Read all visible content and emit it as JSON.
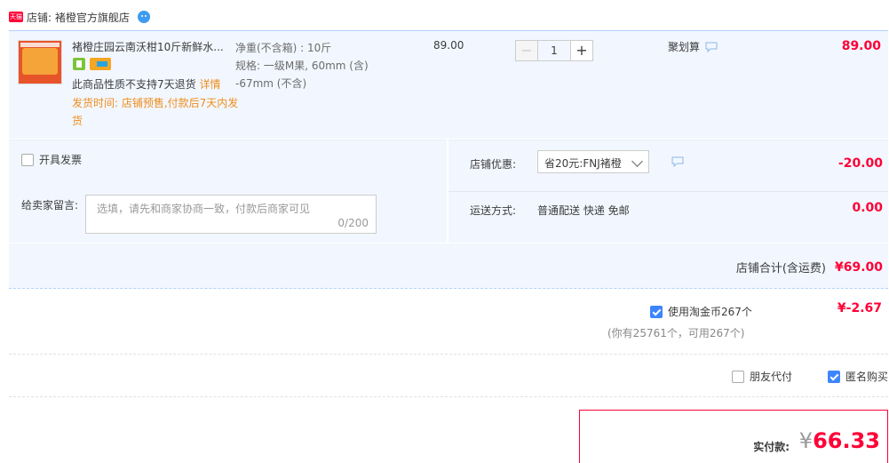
{
  "shop": {
    "badge": "天猫",
    "label": "店铺: 褚橙官方旗舰店"
  },
  "item": {
    "title": "褚橙庄园云南沃柑10斤新鲜水...",
    "service_note": "此商品性质不支持7天退货",
    "detail_link": "详情",
    "ship_time": "发货时间: 店铺预售,付款后7天内发货",
    "sku_line1": "净重(不含箱) : 10斤",
    "sku_line2": "规格: 一级M果, 60mm (含) -67mm (不含)",
    "unit_price": "89.00",
    "quantity": "1",
    "minus": "−",
    "plus": "+",
    "promo": "聚划算",
    "subtotal": "89.00"
  },
  "options": {
    "invoice_label": "开具发票",
    "memo_label": "给卖家留言:",
    "memo_placeholder": "选填，请先和商家协商一致，付款后商家可见",
    "memo_count": "0/200",
    "coupon_label": "店铺优惠:",
    "coupon_value": "省20元:FNJ褚橙",
    "discount": "-20.00",
    "ship_label": "运送方式:",
    "ship_value": "普通配送 快递 免邮",
    "ship_fee": "0.00"
  },
  "totals": {
    "shop_total_label": "店铺合计(含运费)",
    "shop_total": "¥69.00",
    "coin_label": "使用淘金币267个",
    "coin_note": "(你有25761个，可用267个)",
    "coin_amount": "¥-2.67",
    "friend_pay": "朋友代付",
    "anonymous": "匿名购买",
    "pay_label": "实付款:",
    "pay_currency": "¥",
    "pay_amount": "66.33"
  },
  "colors": {
    "accent": "#ff0036",
    "blue": "#3d85ff",
    "orange": "#f08d1c",
    "panel": "#f2f7ff"
  }
}
